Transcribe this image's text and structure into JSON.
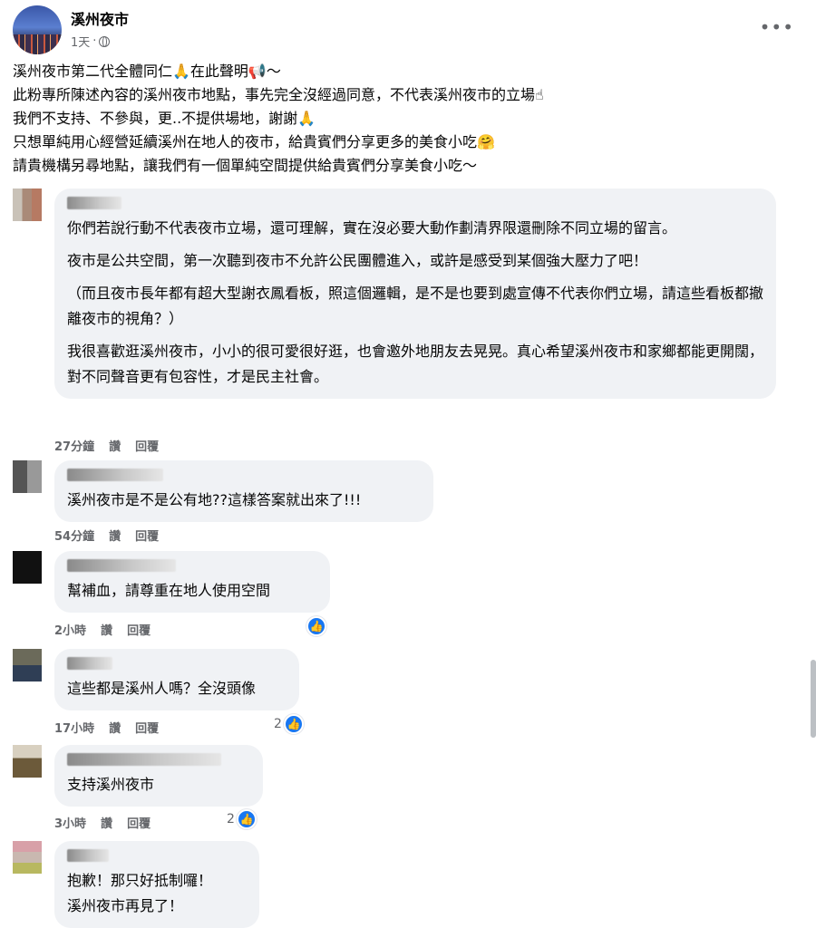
{
  "post": {
    "page_name": "溪州夜市",
    "time": "1天",
    "meta_sep": "·",
    "lines": [
      "溪州夜市第二代全體同仁🙏在此聲明📢～",
      "此粉專所陳述內容的溪州夜市地點，事先完全沒經過同意，不代表溪州夜市的立場☝",
      "我們不支持、不參與，更..不提供場地，謝謝🙏",
      "只想單純用心經營延續溪州在地人的夜市，給貴賓們分享更多的美食小吃🤗",
      "請貴機構另尋地點，讓我們有一個單純空間提供給貴賓們分享美食小吃～"
    ]
  },
  "actions": {
    "like": "讚",
    "reply": "回覆"
  },
  "comments": [
    {
      "paragraphs": [
        "你們若說行動不代表夜市立場，還可理解，實在沒必要大動作劃清界限還刪除不同立場的留言。",
        "夜市是公共空間，第一次聽到夜市不允許公民團體進入，或許是感受到某個強大壓力了吧！",
        "（而且夜市長年都有超大型謝衣鳳看板，照這個邏輯，是不是也要到處宣傳不代表你們立場，請這些看板都撤離夜市的視角？）",
        "我很喜歡逛溪州夜市，小小的很可愛很好逛，也會邀外地朋友去晃晃。真心希望溪州夜市和家鄉都能更開闊，對不同聲音更有包容性，才是民主社會。"
      ],
      "time": "27分鐘"
    },
    {
      "paragraphs": [
        "溪州夜市是不是公有地??這樣答案就出來了!!!"
      ],
      "time": "54分鐘"
    },
    {
      "paragraphs": [
        "幫補血，請尊重在地人使用空間"
      ],
      "time": "2小時"
    },
    {
      "paragraphs": [
        "這些都是溪州人嗎？全沒頭像"
      ],
      "time": "17小時",
      "like_count": "2"
    },
    {
      "paragraphs": [
        "支持溪州夜市"
      ],
      "time": "3小時",
      "like_count": "2"
    },
    {
      "paragraphs": [
        "抱歉！那只好抵制囉！",
        "溪州夜市再見了！"
      ]
    }
  ],
  "colors": {
    "bubble": "#f0f2f5",
    "meta": "#65676b",
    "like_blue": "#1877f2"
  },
  "icons": [
    "globe-icon",
    "more-icon",
    "like-icon"
  ]
}
